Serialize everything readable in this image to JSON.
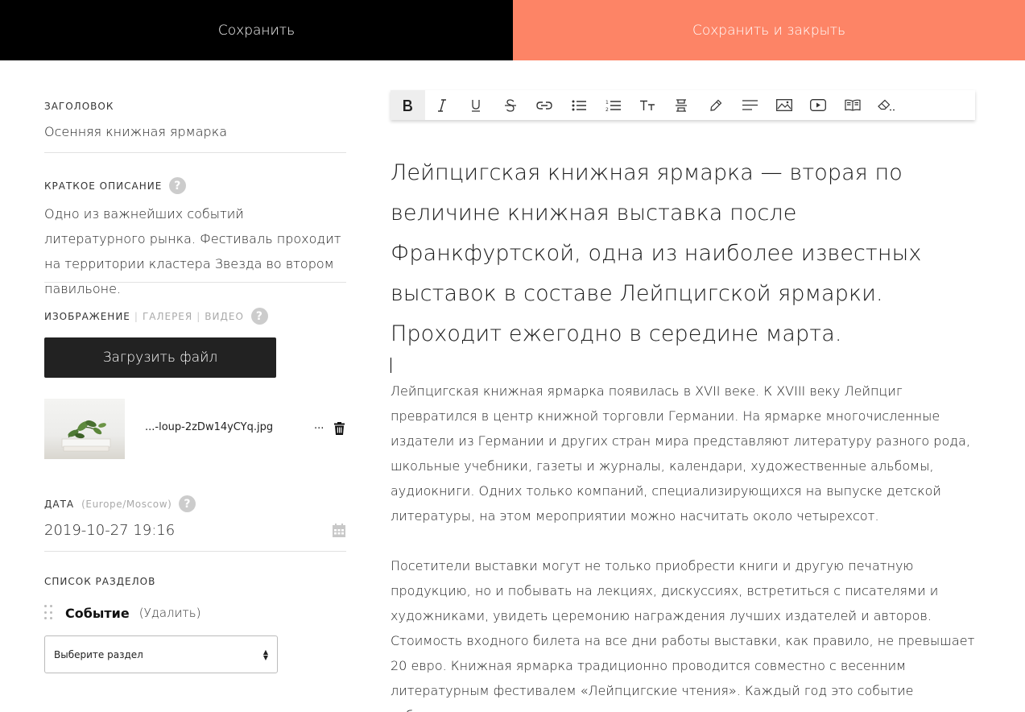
{
  "topbar": {
    "save_label": "Сохранить",
    "save_close_label": "Сохранить и закрыть"
  },
  "form": {
    "title_label": "ЗАГОЛОВОК",
    "title_value": "Осенняя книжная ярмарка",
    "desc_label": "КРАТКОЕ ОПИСАНИЕ",
    "desc_value": "Одно из важнейших событий литературного рынка. Фестиваль проходит на территории кластера Звезда во втором павильоне.",
    "help_glyph": "?",
    "media_tabs": {
      "image": "ИЗОБРАЖЕНИЕ",
      "sep1": "|",
      "gallery": "ГАЛЕРЕЯ",
      "sep2": "|",
      "video": "ВИДЕО"
    },
    "upload_label": "Загрузить файл",
    "file_name": "...-loup-2zDw14yCYq.jpg",
    "file_more": "...",
    "date_label": "ДАТА",
    "date_tz": "(Europe/Moscow)",
    "date_value": "2019-10-27 19:16",
    "sections_label": "СПИСОК РАЗДЕЛОВ",
    "section_name": "Событие",
    "section_delete": "(Удалить)",
    "select_placeholder": "Выберите раздел"
  },
  "toolbar": {
    "buttons": [
      "bold-icon",
      "italic-icon",
      "underline-icon",
      "strikethrough-icon",
      "link-icon",
      "bullet-list-icon",
      "numbered-list-icon",
      "text-size-icon",
      "divider-icon",
      "marker-icon",
      "align-icon",
      "image-icon",
      "video-icon",
      "book-icon",
      "eraser-icon"
    ],
    "active": "bold-icon"
  },
  "editor": {
    "lead": "Лейпцигская книжная ярмарка — вторая по величине книжная выставка после Франкфуртской, одна из наиболее известных выставок в составе Лейпцигской ярмарки. Проходит ежегодно в середине марта.",
    "paragraph1": "Лейпцигская книжная ярмарка появилась в XVII веке. К XVIII веку Лейпциг превратился в центр книжной торговли Германии. На ярмарке многочисленные издатели из Германии и других стран мира представляют литературу разного рода, школьные учебники, газеты и журналы, календари, художественные альбомы, аудиокниги. Одних только компаний, специализирующихся на выпуске детской литературы, на этом мероприятии можно насчитать около четырехсот.",
    "paragraph2": "Посетители выставки могут не только приобрести книги и другую печатную продукцию, но и побывать на лекциях, дискуссиях, встретиться с писателями и художниками, увидеть церемонию награждения лучших издателей и авторов. Стоимость входного билета на все дни работы выставки, как правило, не превышает 20 евро. Книжная ярмарка традиционно проводится совместно с весенним литературным фестивалем «Лейпцигские чтения». Каждый год это событие собирает десятки тысяч поклонников художественного слова."
  },
  "colors": {
    "save_bg": "#000000",
    "save_close_bg": "#fd8466",
    "upload_bg": "#222222"
  }
}
